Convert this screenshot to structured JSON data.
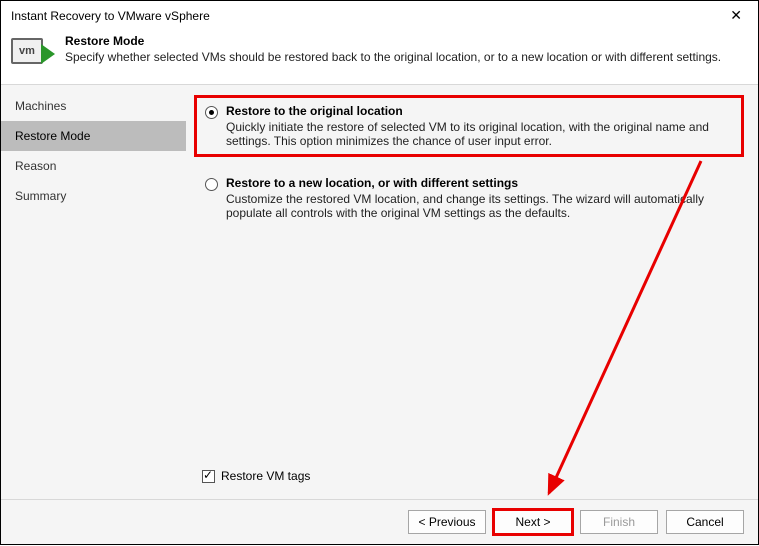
{
  "window": {
    "title": "Instant Recovery to VMware vSphere"
  },
  "header": {
    "title": "Restore Mode",
    "subtitle": "Specify whether selected VMs should be restored back to the original location, or to a new location or with different settings."
  },
  "sidebar": {
    "steps": [
      {
        "label": "Machines"
      },
      {
        "label": "Restore Mode"
      },
      {
        "label": "Reason"
      },
      {
        "label": "Summary"
      }
    ],
    "active_index": 1
  },
  "options": {
    "original": {
      "title": "Restore to the original location",
      "desc": "Quickly initiate the restore of selected VM to its original location, with the original name and settings. This option minimizes the chance of user input error.",
      "checked": true
    },
    "new": {
      "title": "Restore to a new location, or with different settings",
      "desc": "Customize the restored VM location, and change its settings. The wizard will automatically populate all controls with the original VM settings as the defaults.",
      "checked": false
    }
  },
  "checkbox": {
    "label": "Restore VM tags",
    "checked": true
  },
  "footer": {
    "previous": "< Previous",
    "next": "Next >",
    "finish": "Finish",
    "cancel": "Cancel"
  },
  "icon": {
    "vm_text": "vm"
  }
}
